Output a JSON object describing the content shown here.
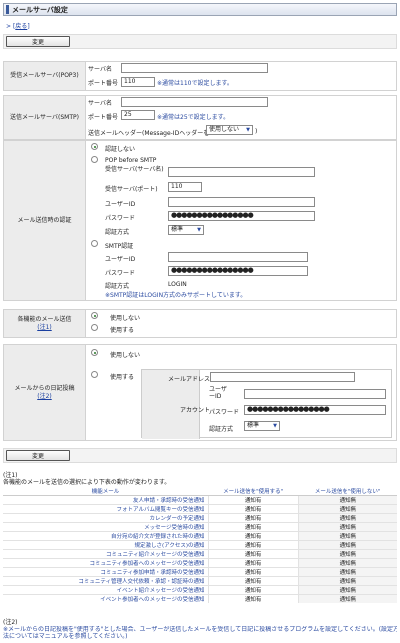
{
  "header": {
    "title": "メールサーバ設定"
  },
  "back": {
    "label": "戻る",
    "prefix": "[",
    "suffix": "]"
  },
  "buttons": {
    "change_top": "変更",
    "change_bottom": "変更"
  },
  "pop3": {
    "label": "受信メールサーバ(POP3)",
    "server_label": "サーバ名",
    "server_value": "",
    "port_label": "ポート番号",
    "port_value": "110",
    "port_hint": "※通常は110で設定します。"
  },
  "smtp": {
    "label": "送信メールサーバ(SMTP)",
    "server_label": "サーバ名",
    "server_value": "",
    "port_label": "ポート番号",
    "port_value": "25",
    "port_hint": "※通常は25で設定します。",
    "header_label": "送信メールヘッダー(Message-IDヘッダーを",
    "header_select": "使用しない",
    "header_suffix": ")"
  },
  "auth": {
    "label": "メール送信時の認証",
    "opt_none": "認証しない",
    "opt_pop": "POP before SMTP",
    "pop_server_label": "受信サーバ(サーバ名)",
    "pop_port_label": "受信サーバ(ポート)",
    "pop_port_value": "110",
    "pop_user_label": "ユーザーID",
    "pop_pass_label": "パスワード",
    "pop_pass_value": "●●●●●●●●●●●●●●●●",
    "pop_method_label": "認証方式",
    "pop_method_value": "標準",
    "opt_smtp": "SMTP認証",
    "smtp_user_label": "ユーザーID",
    "smtp_pass_label": "パスワード",
    "smtp_pass_value": "●●●●●●●●●●●●●●●●",
    "smtp_method_label": "認証方式",
    "smtp_method_value": "LOGIN",
    "smtp_note": "※SMTP認証はLOGIN方式のみサポートしています。"
  },
  "notify": {
    "label": "各機能のメール送信",
    "note": "(注1)",
    "opt_off": "使用しない",
    "opt_on": "使用する"
  },
  "post": {
    "label": "メールからの日記投稿",
    "note": "(注2)",
    "opt_off": "使用しない",
    "opt_on": "使用する",
    "addr_label": "メールアドレス",
    "account_label": "アカウント",
    "user_label": "ユーザーID",
    "pass_label": "パスワード",
    "pass_value": "●●●●●●●●●●●●●●●●",
    "method_label": "認証方式",
    "method_value": "標準"
  },
  "note1": {
    "title": "(注1)",
    "text": "各機能のメールを送信の選択により下表の動作が変わります。"
  },
  "table": {
    "headers": [
      "機能メール",
      "メール送信を\"使用する\"",
      "メール送信を\"使用しない\""
    ],
    "rows": [
      [
        "友人申請・承認時の受信通知",
        "通知有",
        "通知無"
      ],
      [
        "フォトアルバム閲覧キーの受信通知",
        "通知有",
        "通知無"
      ],
      [
        "カレンダーの予定通知",
        "通知有",
        "通知無"
      ],
      [
        "メッセージ受信時の通知",
        "通知有",
        "通知無"
      ],
      [
        "自分宛の紹介文が登録された時の通知",
        "通知有",
        "通知無"
      ],
      [
        "規定激しさ(アクセス)の通知",
        "通知有",
        "通知無"
      ],
      [
        "コミュニティ紹介メッセージの受信通知",
        "通知有",
        "通知無"
      ],
      [
        "コミュニティ参加者へのメッセージの受信通知",
        "通知有",
        "通知無"
      ],
      [
        "コミュニティ参加申請・承認時の受信通知",
        "通知有",
        "通知無"
      ],
      [
        "コミュニティ管理人交代依頼・承認・認証時の通知",
        "通知有",
        "通知無"
      ],
      [
        "イベント紹介メッセージの受信通知",
        "通知有",
        "通知無"
      ],
      [
        "イベント参加者へのメッセージの受信通知",
        "通知有",
        "通知無"
      ]
    ]
  },
  "note2": {
    "title": "(注2)",
    "text1": "※メールからの日記投稿を\"使用する\"とした場合、ユーザーが送信したメールを受信して日記に投稿させるプログラムを設定してください。(設定方",
    "text2": "法についてはマニュアルを参照してください。)"
  }
}
